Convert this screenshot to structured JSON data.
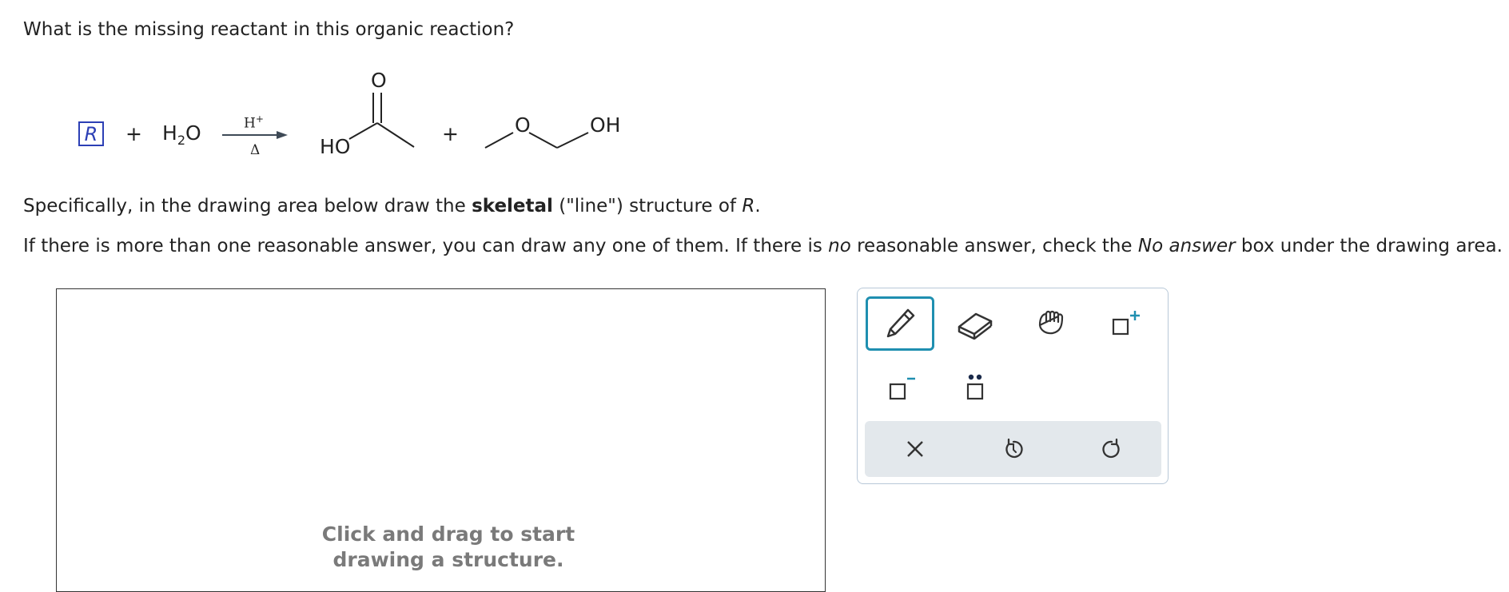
{
  "question": {
    "title": "What is the missing reactant in this organic reaction?"
  },
  "reaction": {
    "reactant_placeholder": "R",
    "plus": "+",
    "water_h": "H",
    "water_sub": "2",
    "water_o": "O",
    "catalyst_h": "H",
    "catalyst_sup": "+",
    "condition": "Δ",
    "product1_oxygen": "O",
    "product1_ho": "HO",
    "product2_oxygen": "O",
    "product2_oh": "OH"
  },
  "instructions": {
    "line1_pre": "Specifically, in the drawing area below draw the ",
    "line1_bold": "skeletal",
    "line1_mid": " (\"line\") structure of ",
    "line1_var": "R",
    "line1_end": ".",
    "line2_pre": "If there is more than one reasonable answer, you can draw any one of them. If there is ",
    "line2_em1": "no",
    "line2_mid": " reasonable answer, check the ",
    "line2_em2": "No answer",
    "line2_end": " box under the drawing area."
  },
  "canvas": {
    "hint": "Click and drag to start drawing a structure."
  },
  "toolbar": {
    "tools": [
      "pencil-icon",
      "eraser-icon",
      "hand-icon",
      "add-charge-icon",
      "remove-charge-icon",
      "lone-pair-icon"
    ],
    "actions": [
      "clear-icon",
      "undo-icon",
      "redo-icon"
    ],
    "colors": {
      "active_border": "#1f8fb0",
      "action_bar": "#e3e8ec",
      "reactant_box": "#2c3fb5"
    }
  }
}
